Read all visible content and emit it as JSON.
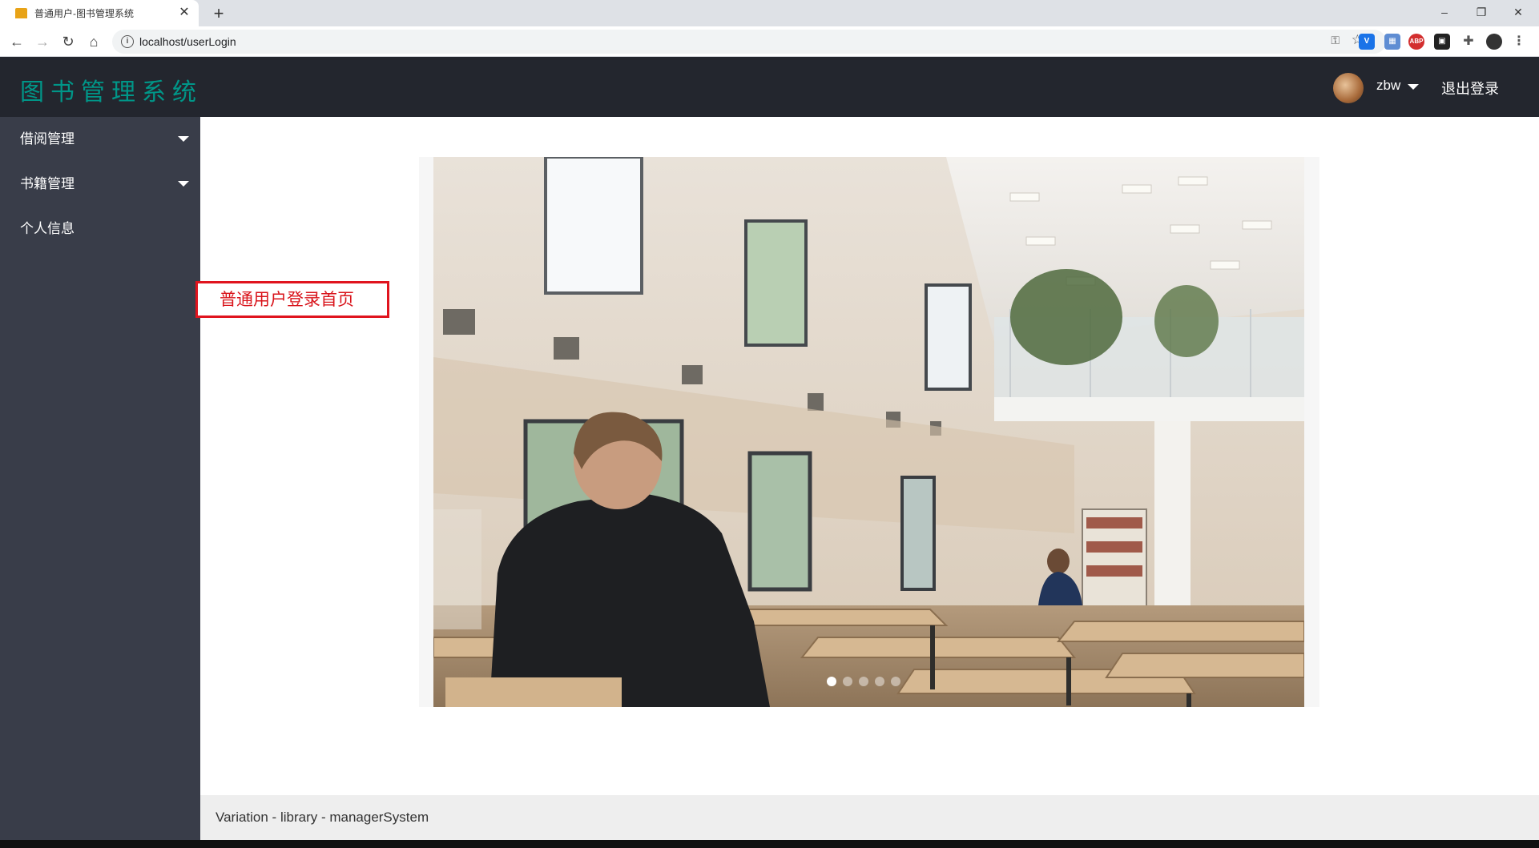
{
  "browser": {
    "tab_title": "普通用户-图书管理系统",
    "close_glyph": "✕",
    "newtab_glyph": "+",
    "url": "localhost/userLogin"
  },
  "app": {
    "logo": "图书管理系统",
    "username": "zbw",
    "logout": "退出登录",
    "sidebar": {
      "items": [
        {
          "label": "借阅管理",
          "has_submenu": true
        },
        {
          "label": "书籍管理",
          "has_submenu": true
        },
        {
          "label": "个人信息",
          "has_submenu": false
        }
      ]
    },
    "annotation": "普通用户登录首页",
    "carousel": {
      "slide_count": 5,
      "active_index": 0
    },
    "footer": "Variation - library - managerSystem"
  },
  "colors": {
    "header_bg": "#23262e",
    "sidebar_bg": "#393d49",
    "logo": "#009688",
    "annotation": "#e0141e"
  }
}
